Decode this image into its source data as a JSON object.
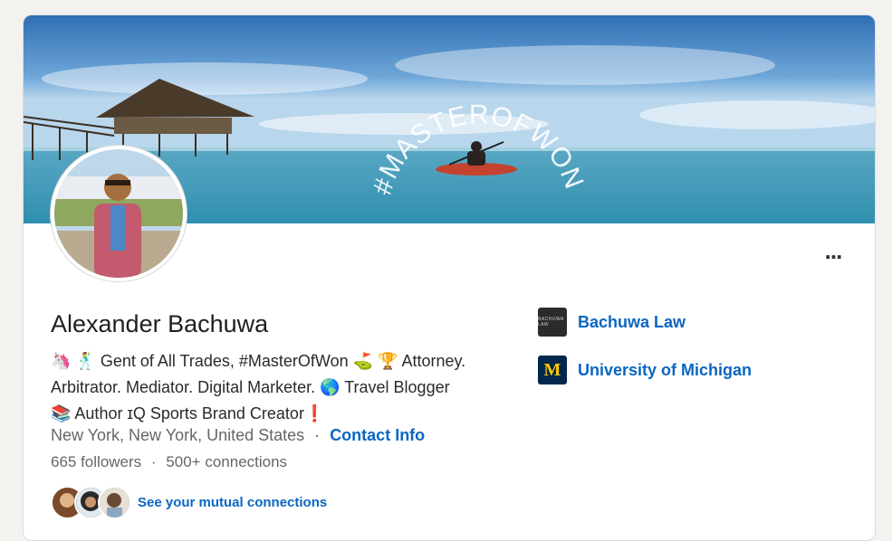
{
  "profile": {
    "name": "Alexander Bachuwa",
    "headline_line1": "🦄 🕺 Gent of All Trades, #MasterOfWon ⛳ 🏆 Attorney.",
    "headline_line2": "Arbitrator. Mediator. Digital Marketer. 🌎 Travel Blogger",
    "headline_line3": "📚 Author ɪQ Sports Brand Creator❗",
    "location": "New York, New York, United States",
    "separator": "·",
    "contact_info": "Contact Info",
    "followers": "665 followers",
    "connections": "500+ connections",
    "mutual_connections": "See your mutual connections"
  },
  "banner": {
    "text": "#MASTEROFWON"
  },
  "organizations": [
    {
      "name": "Bachuwa Law",
      "logo_text": "BACHUWA LAW",
      "logo_bg": "#2b2b2b",
      "logo_color": "#cfcfcf",
      "icon": "bachuwa-law-logo-icon"
    },
    {
      "name": "University of Michigan",
      "logo_text": "M",
      "logo_bg": "#00274c",
      "logo_color": "#ffcb05",
      "icon": "umich-logo-icon"
    }
  ],
  "colors": {
    "link": "#0a66c2",
    "text": "#1f1f1f",
    "muted": "#666666"
  },
  "more_menu": "..."
}
